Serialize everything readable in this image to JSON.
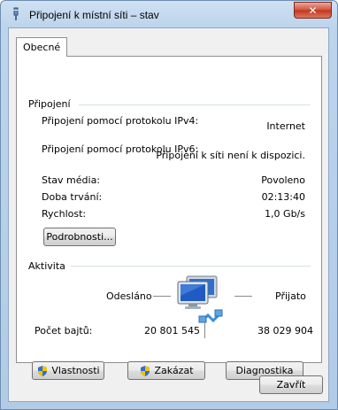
{
  "window": {
    "title": "Připojení k místní síti – stav",
    "close_glyph": "✕"
  },
  "tabs": [
    {
      "label": "Obecné",
      "active": true
    }
  ],
  "connection": {
    "group_title": "Připojení",
    "rows": [
      {
        "label": "Připojení pomocí protokolu IPv4:",
        "value": "Internet"
      },
      {
        "label": "Připojení pomocí protokolu IPv6:",
        "value": "Připojení k síti není k dispozici."
      },
      {
        "label": "Stav média:",
        "value": "Povoleno"
      },
      {
        "label": "Doba trvání:",
        "value": "02:13:40"
      },
      {
        "label": "Rychlost:",
        "value": "1,0 Gb/s"
      }
    ],
    "details_button": "Podrobnosti..."
  },
  "activity": {
    "group_title": "Aktivita",
    "sent_label": "Odesláno",
    "received_label": "Přijato",
    "bytes_label": "Počet bajtů:",
    "bytes_sent": "20 801 545",
    "bytes_received": "38 029 904"
  },
  "buttons": {
    "properties": "Vlastnosti",
    "disable": "Zakázat",
    "diagnostics": "Diagnostika",
    "close": "Zavřít"
  },
  "icons": {
    "app": "network-connection-icon",
    "activity": "network-computers-icon",
    "shield": "uac-shield-icon"
  },
  "colors": {
    "title_bar": "#bcd4ec",
    "close_button": "#c3361d",
    "group_line": "#d5dfe5",
    "panel_bg": "#ffffff",
    "dialog_bg": "#f0f0f0"
  }
}
